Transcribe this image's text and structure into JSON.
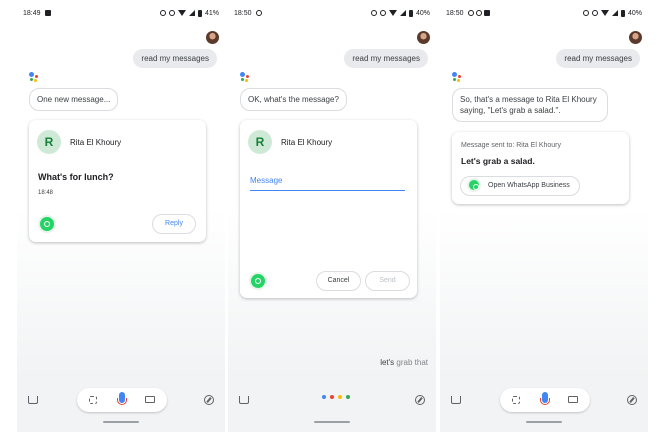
{
  "screens": [
    {
      "status": {
        "time": "18:49",
        "battery": "41%"
      },
      "user_query": "read my messages",
      "assistant_reply": "One new message...",
      "card": {
        "contact_initial": "R",
        "contact_name": "Rita El Khoury",
        "message": "What's for lunch?",
        "time": "18:48",
        "reply_button": "Reply"
      }
    },
    {
      "status": {
        "time": "18:50",
        "battery": "40%"
      },
      "user_query": "read my messages",
      "assistant_reply": "OK, what's the message?",
      "card": {
        "contact_initial": "R",
        "contact_name": "Rita El Khoury",
        "message_placeholder": "Message",
        "cancel_button": "Cancel",
        "send_button": "Send"
      },
      "transcription": {
        "spoken": "let's",
        "pending": "grab that"
      }
    },
    {
      "status": {
        "time": "18:50",
        "battery": "40%"
      },
      "user_query": "read my messages",
      "assistant_reply": "So, that's a message to Rita El Khoury saying, \"Let's grab a salad.\".",
      "card": {
        "sent_label": "Message sent to: Rita El Khoury",
        "message": "Let's grab a salad.",
        "open_app_button": "Open WhatsApp Business"
      }
    }
  ],
  "colors": {
    "accent_blue": "#4285f4",
    "whatsapp_green": "#25d366",
    "contact_avatar_bg": "#ceead6"
  }
}
